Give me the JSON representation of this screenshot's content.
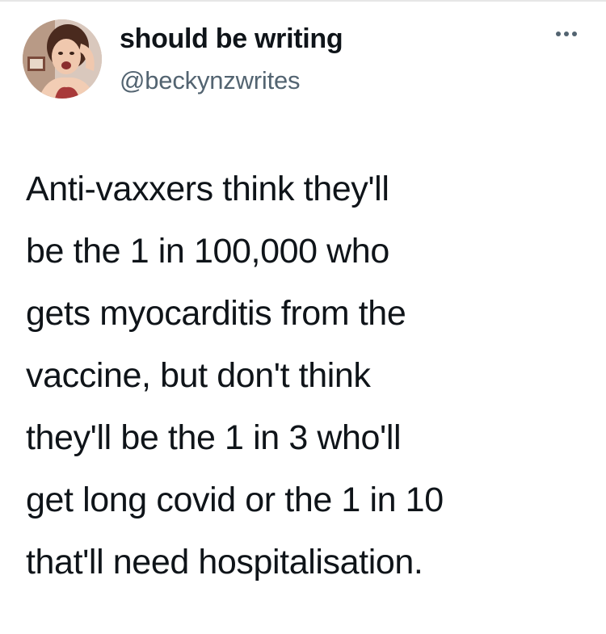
{
  "tweet": {
    "author": {
      "display_name": "should be writing",
      "handle": "@beckynzwrites"
    },
    "more_icon": "more-horizontal-icon",
    "text": "Anti-vaxxers think they'll\nbe the 1 in 100,000 who\ngets myocarditis from the\nvaccine, but don't think\nthey'll be the 1 in 3 who'll\nget long covid or the 1 in 10\nthat'll need hospitalisation."
  }
}
